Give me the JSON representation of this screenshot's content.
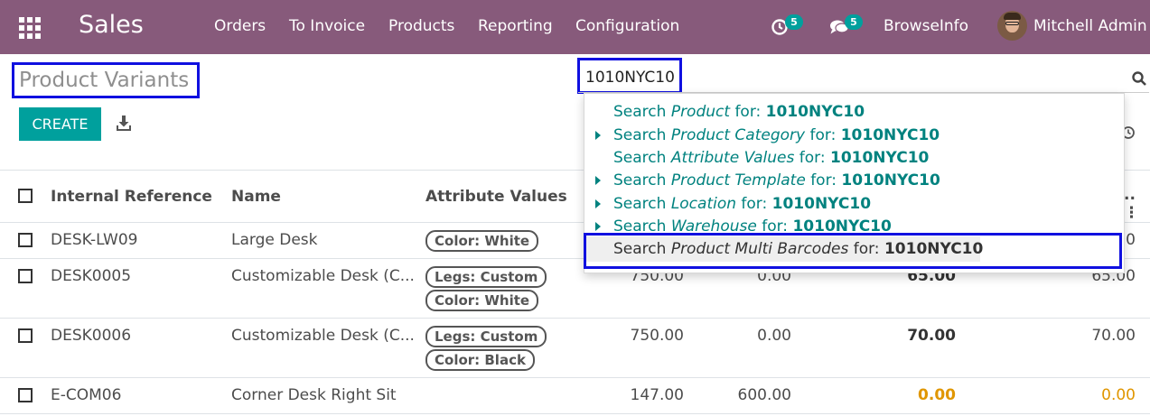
{
  "navbar": {
    "app_name": "Sales",
    "menu": [
      "Orders",
      "To Invoice",
      "Products",
      "Reporting",
      "Configuration"
    ],
    "activity_badge": "5",
    "message_badge": "5",
    "company": "BrowseInfo",
    "user_name": "Mitchell Admin"
  },
  "page": {
    "title": "Product Variants",
    "create_label": "CREATE"
  },
  "search": {
    "value": "1010NYC10"
  },
  "dropdown": {
    "items": [
      {
        "prefix": "Search ",
        "field": "Product",
        "suffix": " for: ",
        "term": "1010NYC10",
        "expandable": false,
        "active": false
      },
      {
        "prefix": "Search ",
        "field": "Product Category",
        "suffix": " for: ",
        "term": "1010NYC10",
        "expandable": true,
        "active": false
      },
      {
        "prefix": "Search ",
        "field": "Attribute Values",
        "suffix": " for: ",
        "term": "1010NYC10",
        "expandable": false,
        "active": false
      },
      {
        "prefix": "Search ",
        "field": "Product Template",
        "suffix": " for: ",
        "term": "1010NYC10",
        "expandable": true,
        "active": false
      },
      {
        "prefix": "Search ",
        "field": "Location",
        "suffix": " for: ",
        "term": "1010NYC10",
        "expandable": true,
        "active": false
      },
      {
        "prefix": "Search ",
        "field": "Warehouse",
        "suffix": " for: ",
        "term": "1010NYC10",
        "expandable": true,
        "active": false
      },
      {
        "prefix": "Search ",
        "field": "Product Multi Barcodes",
        "suffix": " for: ",
        "term": "1010NYC10",
        "expandable": false,
        "active": true
      }
    ]
  },
  "table": {
    "headers": {
      "internal_reference": "Internal Reference",
      "name": "Name",
      "attribute_values": "Attribute Values",
      "more": ".."
    },
    "rows": [
      {
        "ref": "DESK-LW09",
        "name": "Large Desk",
        "tags": [
          "Color: White"
        ],
        "price": "",
        "cost": "",
        "qty": "",
        "forecast": "00"
      },
      {
        "ref": "DESK0005",
        "name": "Customizable Desk (C...",
        "tags": [
          "Legs: Custom",
          "Color: White"
        ],
        "price": "750.00",
        "cost": "0.00",
        "qty": "65.00",
        "forecast": "65.00"
      },
      {
        "ref": "DESK0006",
        "name": "Customizable Desk (C...",
        "tags": [
          "Legs: Custom",
          "Color: Black"
        ],
        "price": "750.00",
        "cost": "0.00",
        "qty": "70.00",
        "forecast": "70.00"
      },
      {
        "ref": "E-COM06",
        "name": "Corner Desk Right Sit",
        "tags": [],
        "price": "147.00",
        "cost": "600.00",
        "qty": "0.00",
        "forecast": "0.00"
      }
    ]
  },
  "colors": {
    "navbar": "#875a7b",
    "primary": "#00a09d",
    "highlight_box": "#1010e0",
    "warning": "#e09600"
  },
  "icons": [
    "apps-grid-icon",
    "activity-clock-icon",
    "chat-icon",
    "download-icon",
    "search-icon",
    "history-icon"
  ]
}
